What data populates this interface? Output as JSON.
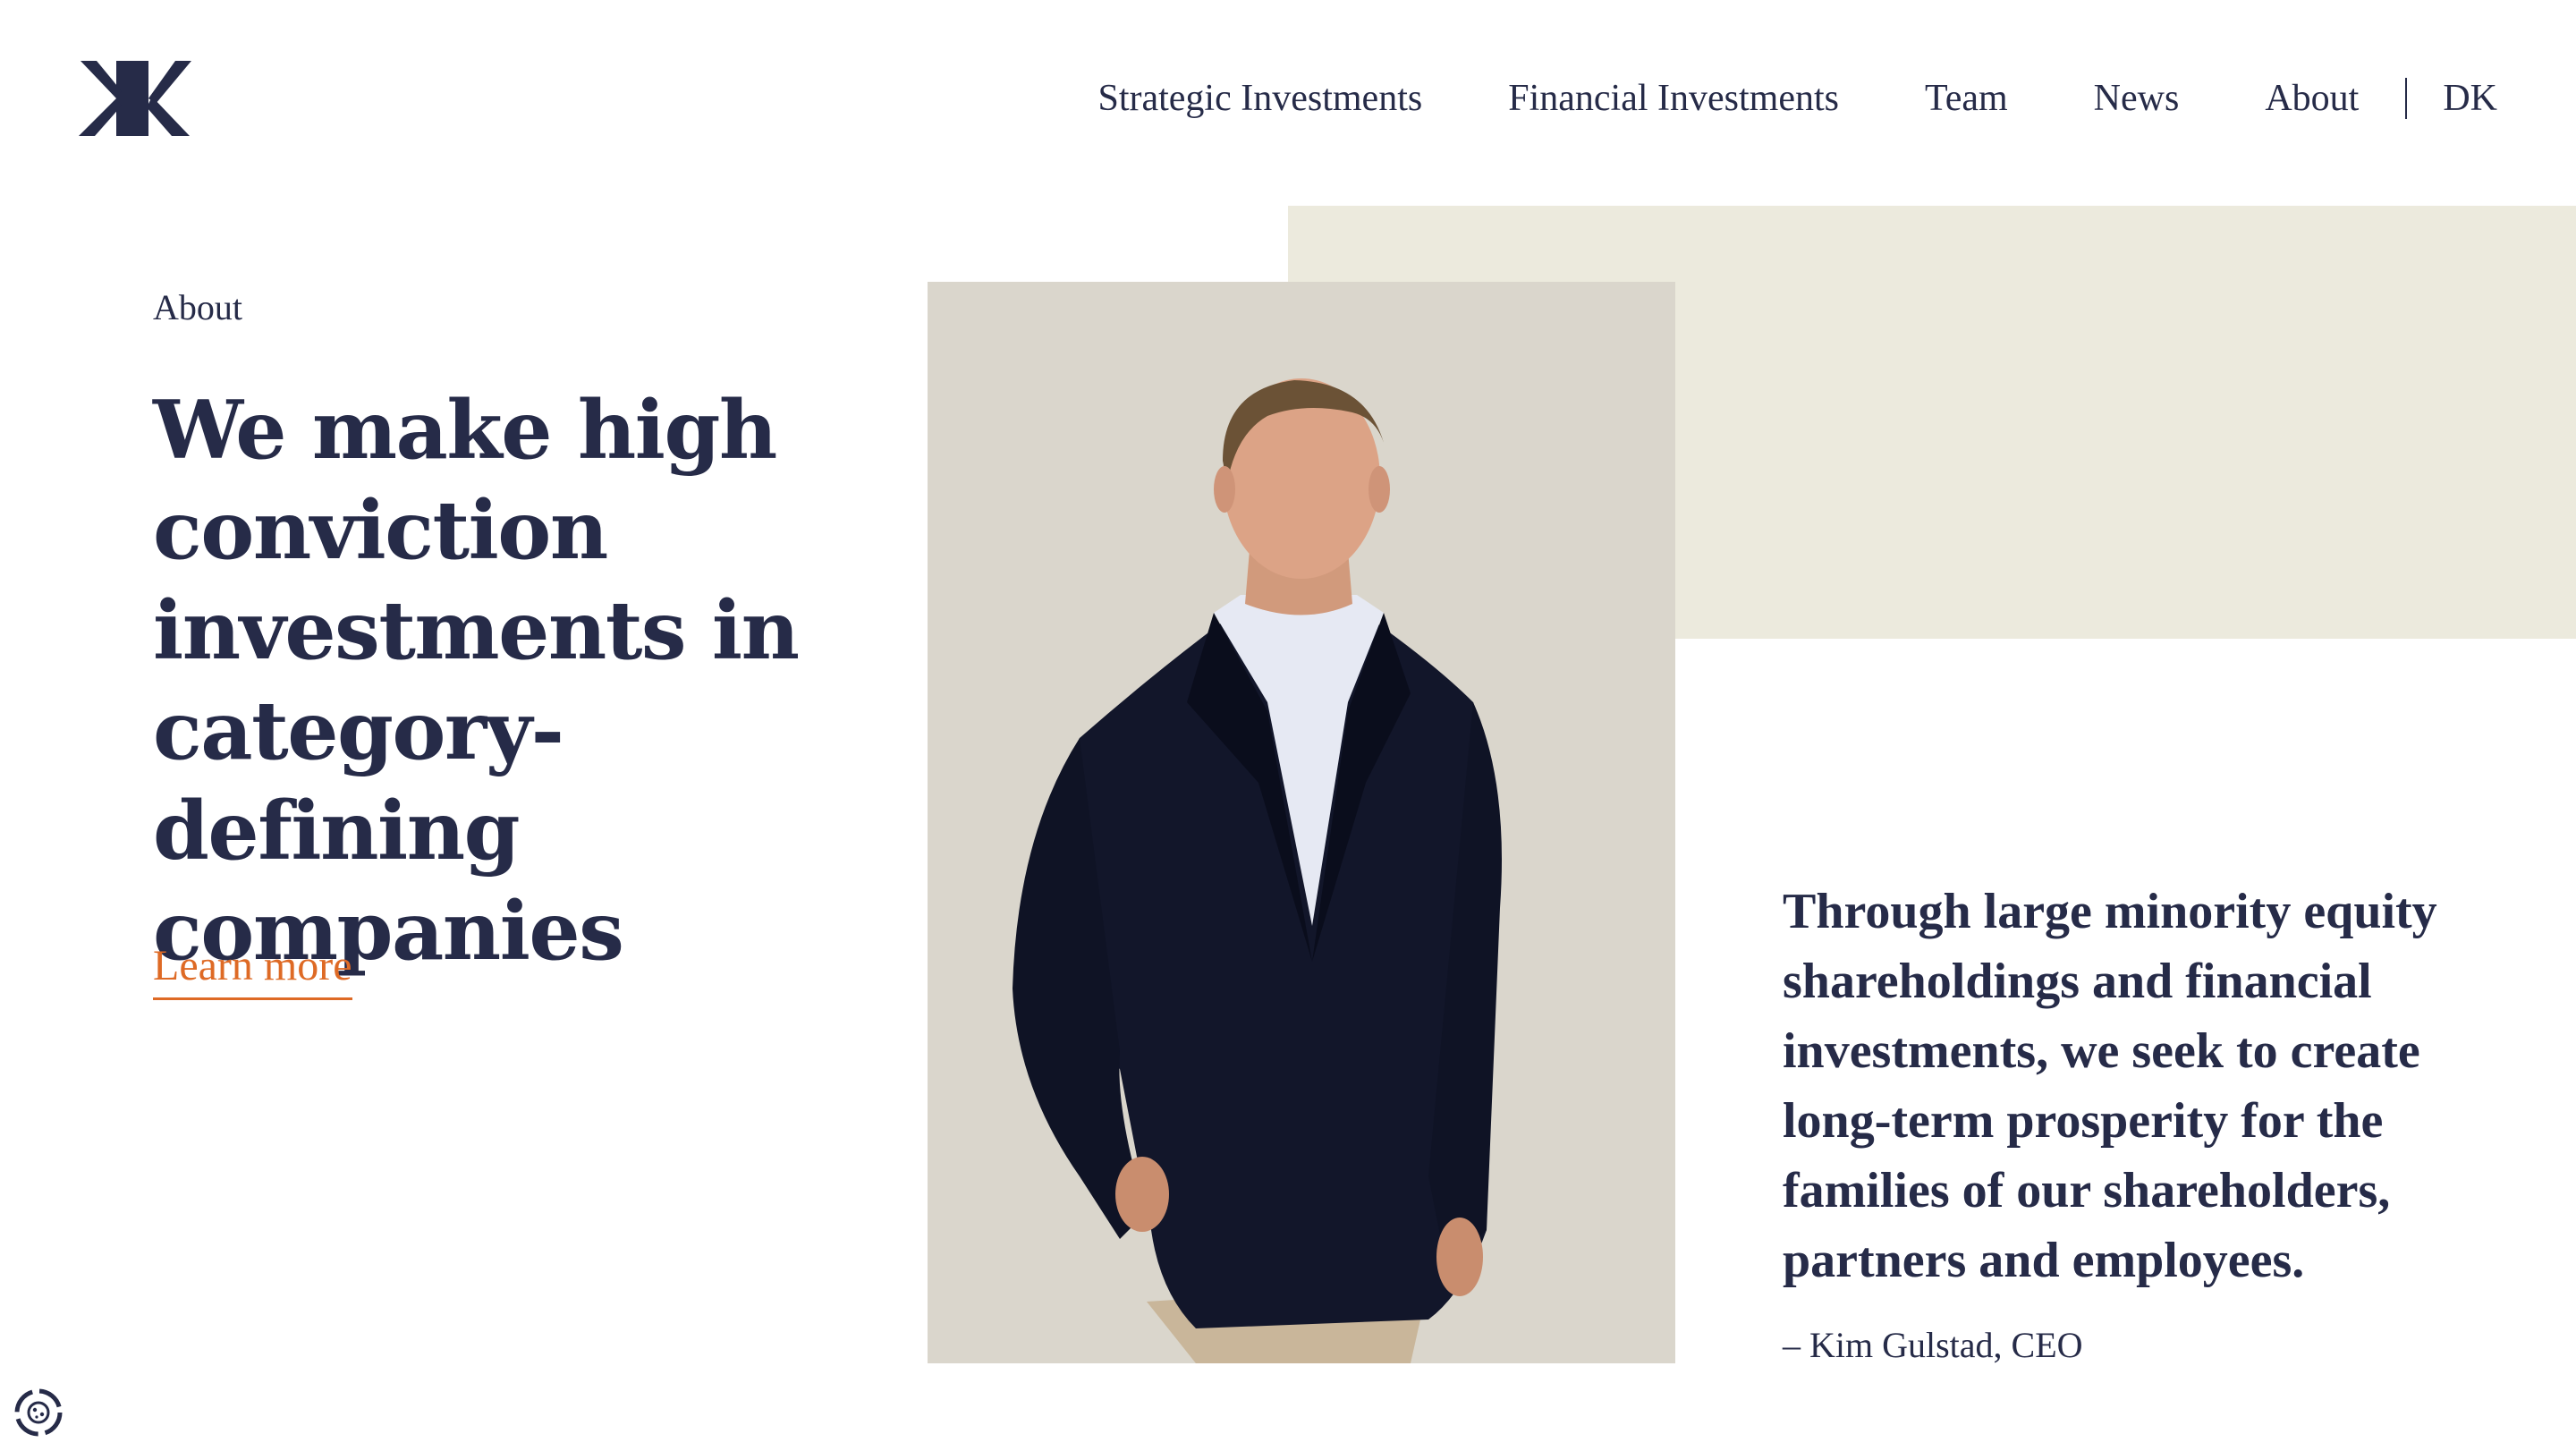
{
  "brand": {
    "logo_icon": "kk-monogram-logo"
  },
  "nav": {
    "items": [
      "Strategic Investments",
      "Financial Investments",
      "Team",
      "News",
      "About"
    ],
    "lang": "DK"
  },
  "hero": {
    "eyebrow": "About",
    "headline": "We make high conviction investments in category-defining companies",
    "cta": "Learn more"
  },
  "quote": {
    "text": "Through large minority equity shareholdings and financial investments, we seek to create long-term prosperity for the families of our shareholders, partners and employees.",
    "attribution": "– Kim Gulstad, CEO"
  },
  "colors": {
    "navy": "#262b48",
    "accent_orange": "#de6a25",
    "beige": "#eceadd",
    "photo_bg": "#dad6cc"
  },
  "widgets": {
    "cookie_icon": "cookie-consent-icon"
  }
}
